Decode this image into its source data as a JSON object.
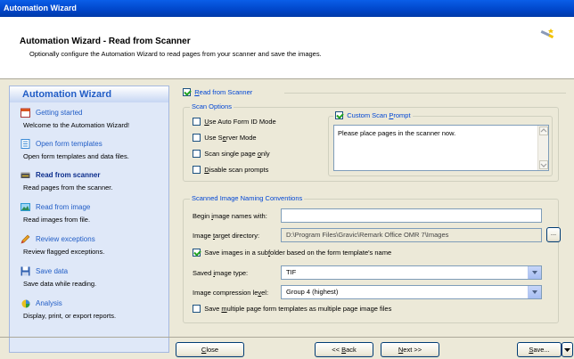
{
  "window": {
    "title": "Automation Wizard"
  },
  "header": {
    "title": "Automation Wizard - Read from Scanner",
    "subtitle": "Optionally configure the Automation Wizard to read pages from your scanner and save the images."
  },
  "sidebar": {
    "title": "Automation Wizard",
    "items": [
      {
        "label": "Getting started",
        "desc": "Welcome to the Automation Wizard!",
        "icon": "calendar-icon",
        "color": "#d9541e"
      },
      {
        "label": "Open form templates",
        "desc": "Open form templates and data files.",
        "icon": "form-icon",
        "color": "#3a8ad6"
      },
      {
        "label": "Read from scanner",
        "desc": "Read pages from the scanner.",
        "icon": "scanner-icon",
        "color": "#444444",
        "active": true
      },
      {
        "label": "Read from image",
        "desc": "Read images from file.",
        "icon": "image-icon",
        "color": "#2a9ad4"
      },
      {
        "label": "Review exceptions",
        "desc": "Review flagged exceptions.",
        "icon": "pencil-icon",
        "color": "#e8a020"
      },
      {
        "label": "Save data",
        "desc": "Save data while reading.",
        "icon": "floppy-icon",
        "color": "#3060b0"
      },
      {
        "label": "Analysis",
        "desc": "Display, print, or export reports.",
        "icon": "analysis-icon",
        "color": "#e8c020"
      }
    ]
  },
  "main": {
    "read_from_scanner": {
      "mnemonic": "R",
      "rest": "ead from Scanner",
      "checked": true
    },
    "scan_options": {
      "legend": "Scan Options",
      "use_auto_form_id": {
        "mnemonic": "U",
        "rest": "se Auto Form ID Mode",
        "checked": false
      },
      "use_server_mode": {
        "before": "Use S",
        "mnemonic": "e",
        "after": "rver Mode",
        "checked": false
      },
      "scan_single_page": {
        "before": "Scan single page ",
        "mnemonic": "o",
        "after": "nly",
        "checked": false
      },
      "disable_scan_prompts": {
        "mnemonic": "D",
        "rest": "isable scan prompts",
        "checked": false
      },
      "custom_prompt": {
        "before": "Custom Scan ",
        "mnemonic": "P",
        "after": "rompt",
        "checked": true,
        "text": "Please place pages in the scanner now."
      }
    },
    "naming": {
      "legend": "Scanned Image Naming Conventions",
      "begin_label": {
        "before": "Begin ",
        "mnemonic": "i",
        "after": "mage names with:"
      },
      "begin_value": "",
      "target_label": {
        "before": "Image ",
        "mnemonic": "t",
        "after": "arget directory:"
      },
      "target_value": "D:\\Program Files\\Gravic\\Remark Office OMR 7\\Images",
      "browse_label": "...",
      "subfolder": {
        "before": "Save images in a sub",
        "mnemonic": "f",
        "after": "older based on the form template's name",
        "checked": true
      },
      "type_label": {
        "before": "Saved ",
        "mnemonic": "i",
        "after": "mage type:"
      },
      "type_value": "TIF",
      "compression_label": {
        "before": "Image compression le",
        "mnemonic": "v",
        "after": "el:"
      },
      "compression_value": "Group 4 (highest)",
      "multi_page": {
        "before": "Save ",
        "mnemonic": "m",
        "after": "ultiple page form templates as multiple page image files",
        "checked": false
      }
    }
  },
  "buttons": {
    "close": {
      "mnemonic": "C",
      "rest": "lose"
    },
    "back": {
      "before": "<< ",
      "mnemonic": "B",
      "after": "ack"
    },
    "next": {
      "mnemonic": "N",
      "rest": "ext >>"
    },
    "save": {
      "mnemonic": "S",
      "rest": "ave..."
    }
  }
}
